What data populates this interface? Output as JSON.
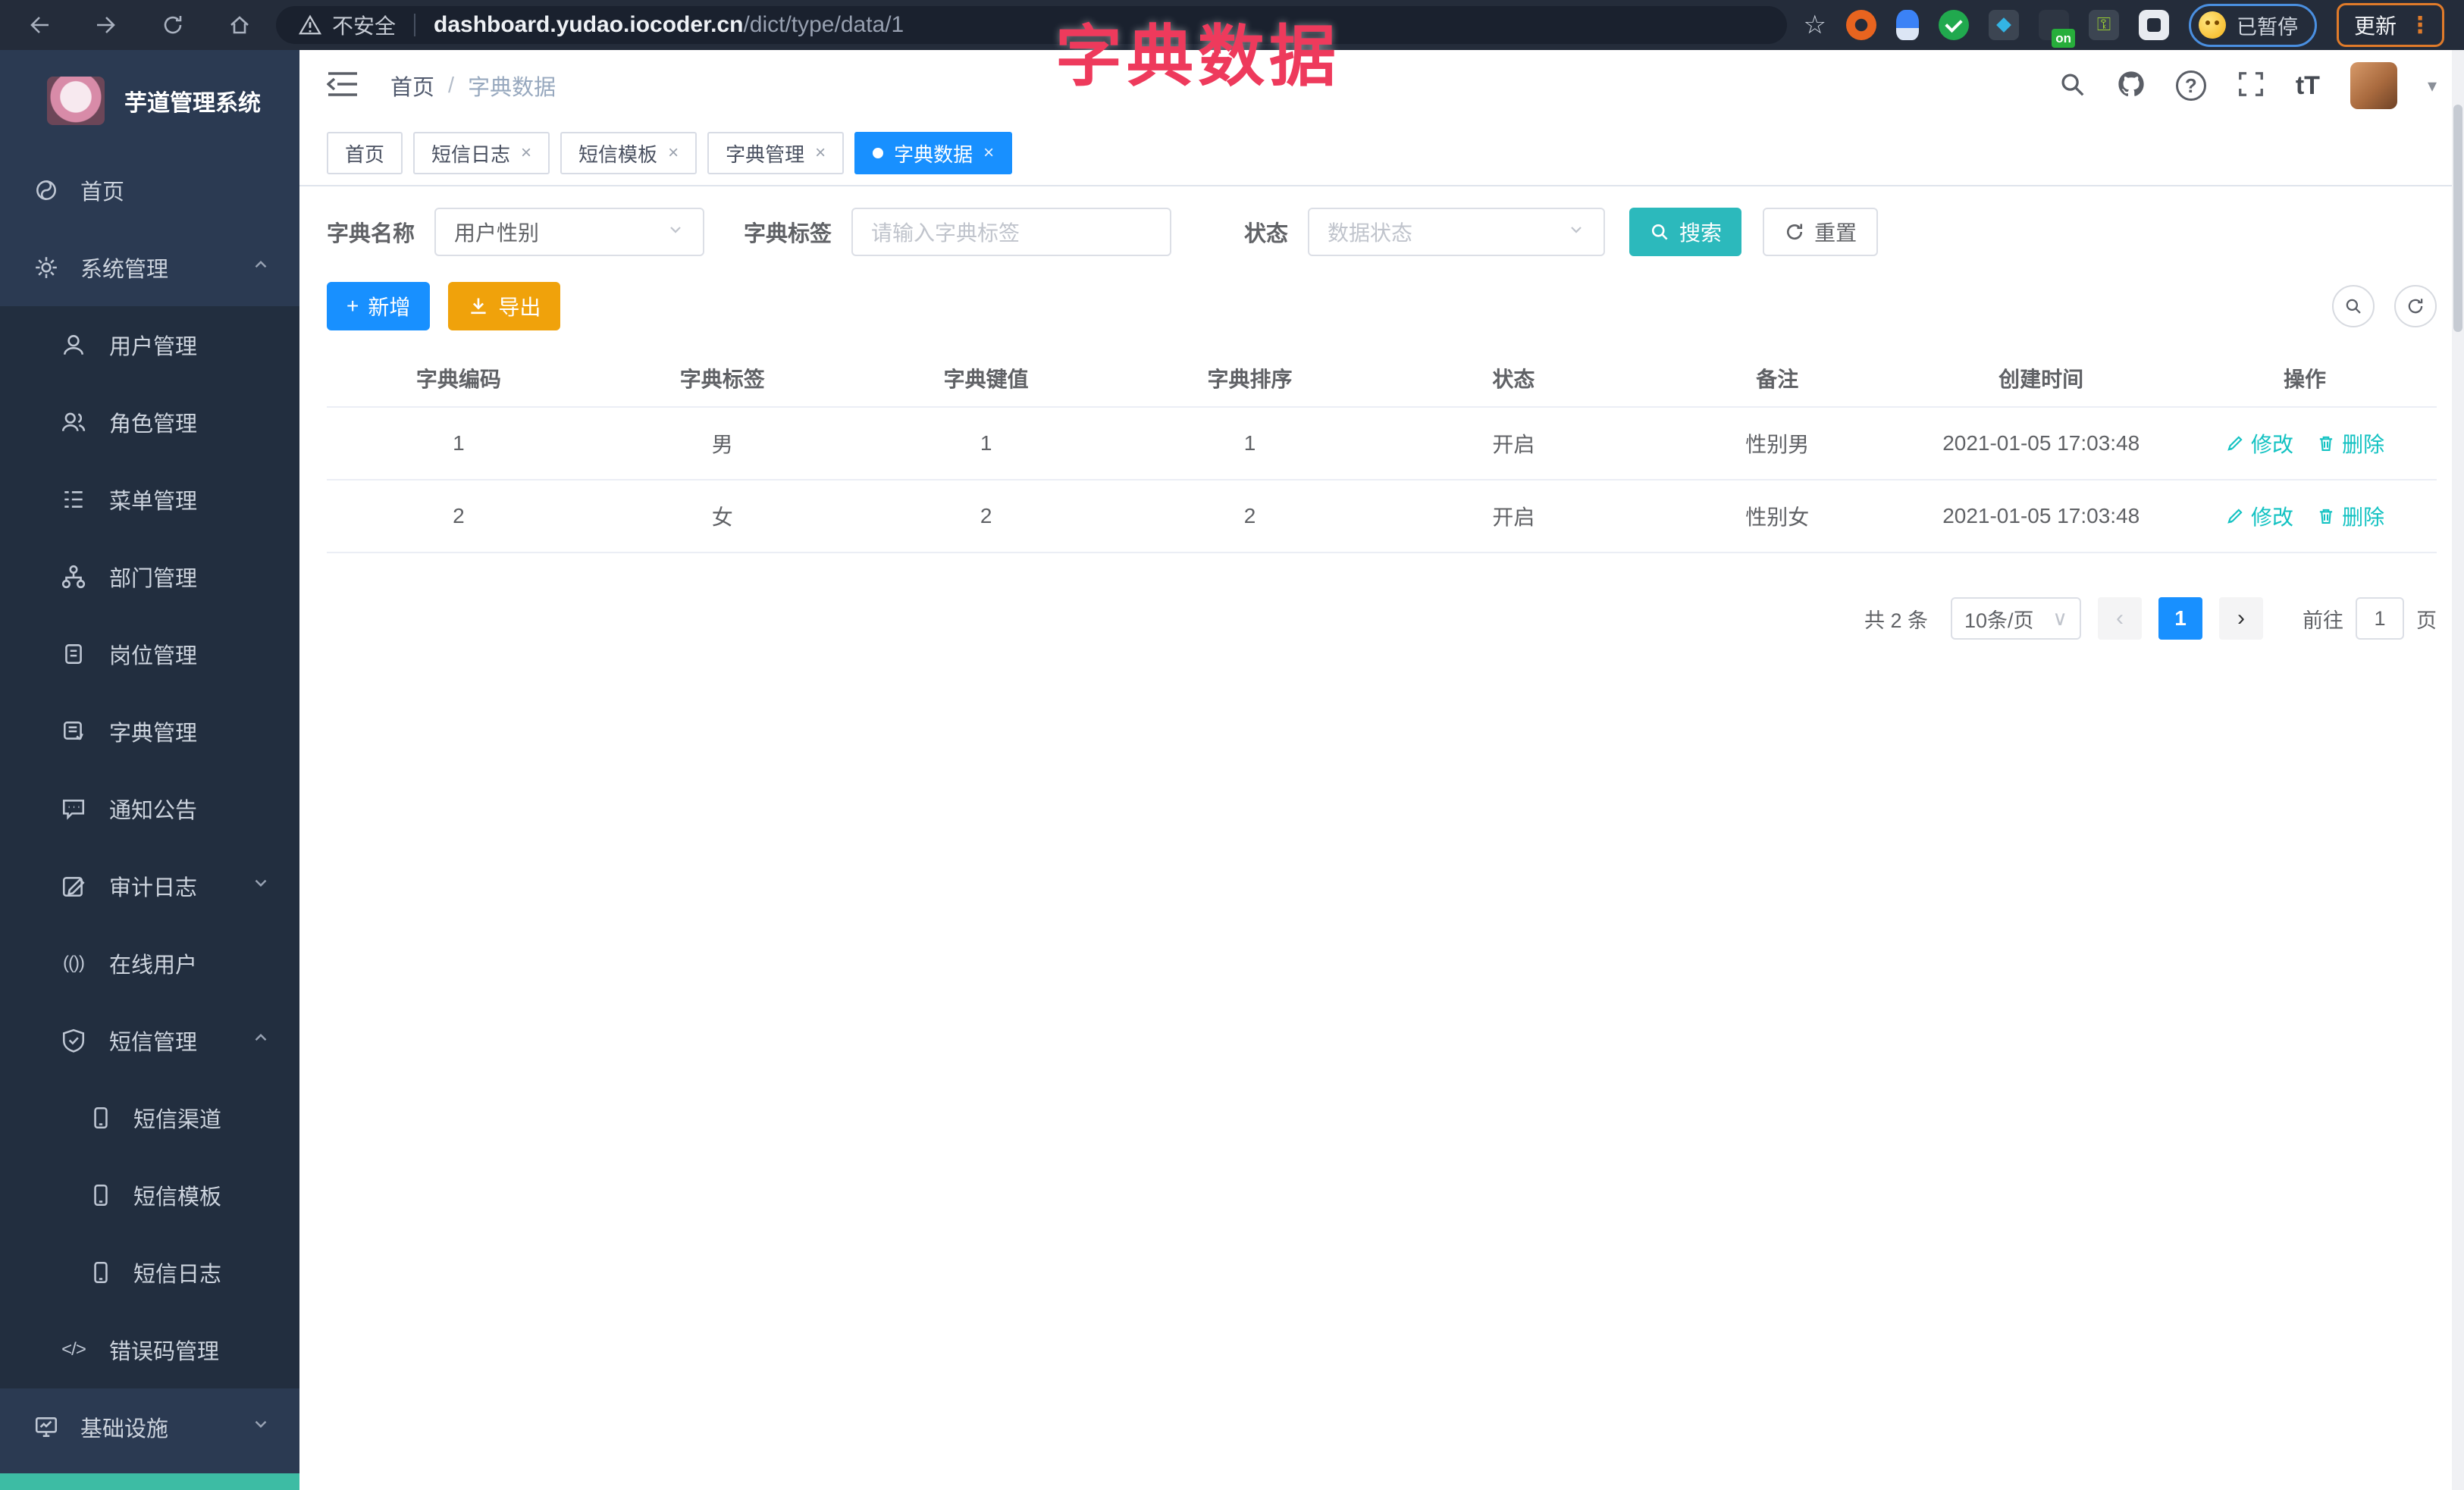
{
  "browser": {
    "security_label": "不安全",
    "url_domain": "dashboard.yudao.iocoder.cn",
    "url_path": "/dict/type/data/1",
    "paused_label": "已暂停",
    "update_label": "更新",
    "on_badge": "on"
  },
  "overlay_title": "字典数据",
  "icons": {
    "close": "×",
    "plus": "+",
    "dots_vertical": "⋮",
    "question": "?",
    "font_size": "tT",
    "star": "☆",
    "key": "⚿",
    "code": "</>",
    "online": "(())",
    "chevron_left": "‹",
    "chevron_right": "›",
    "crumb_sep": "/"
  },
  "sidebar": {
    "logo_title": "芋道管理系统",
    "items": [
      {
        "label": "首页"
      },
      {
        "label": "系统管理"
      },
      {
        "label": "用户管理"
      },
      {
        "label": "角色管理"
      },
      {
        "label": "菜单管理"
      },
      {
        "label": "部门管理"
      },
      {
        "label": "岗位管理"
      },
      {
        "label": "字典管理"
      },
      {
        "label": "通知公告"
      },
      {
        "label": "审计日志"
      },
      {
        "label": "在线用户"
      },
      {
        "label": "短信管理"
      },
      {
        "label": "短信渠道"
      },
      {
        "label": "短信模板"
      },
      {
        "label": "短信日志"
      },
      {
        "label": "错误码管理"
      },
      {
        "label": "基础设施"
      }
    ]
  },
  "header": {
    "breadcrumb_home": "首页",
    "breadcrumb_current": "字典数据"
  },
  "tabs": [
    {
      "label": "首页"
    },
    {
      "label": "短信日志"
    },
    {
      "label": "短信模板"
    },
    {
      "label": "字典管理"
    },
    {
      "label": "字典数据"
    }
  ],
  "filters": {
    "name_label": "字典名称",
    "name_value": "用户性别",
    "tag_label": "字典标签",
    "tag_placeholder": "请输入字典标签",
    "status_label": "状态",
    "status_placeholder": "数据状态",
    "search_label": "搜索",
    "reset_label": "重置"
  },
  "toolbar": {
    "add_label": "新增",
    "export_label": "导出"
  },
  "table": {
    "headers": [
      "字典编码",
      "字典标签",
      "字典键值",
      "字典排序",
      "状态",
      "备注",
      "创建时间",
      "操作"
    ],
    "rows": [
      {
        "cells": [
          "1",
          "男",
          "1",
          "1",
          "开启",
          "性别男",
          "2021-01-05 17:03:48"
        ]
      },
      {
        "cells": [
          "2",
          "女",
          "2",
          "2",
          "开启",
          "性别女",
          "2021-01-05 17:03:48"
        ]
      }
    ],
    "action_edit": "修改",
    "action_delete": "删除"
  },
  "pagination": {
    "total": "共 2 条",
    "page_size": "10条/页",
    "current_page": "1",
    "goto_label": "前往",
    "goto_value": "1",
    "page_suffix": "页"
  },
  "colors": {
    "accent_blue": "#1890ff",
    "search_teal": "#2cb9bc",
    "export_orange": "#f0a20b",
    "link_teal": "#13c2c2",
    "overlay_red": "#ee3a5c",
    "sidebar_bg": "#2b3a52",
    "sidebar_submenu_bg": "#222e3f"
  }
}
